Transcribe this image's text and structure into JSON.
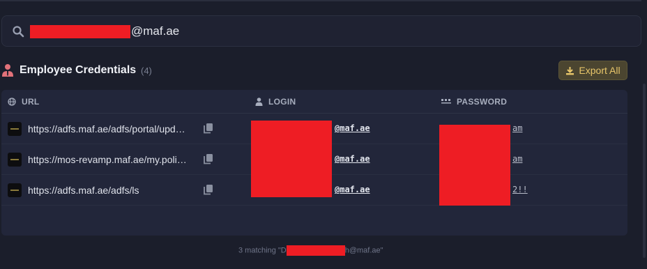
{
  "search": {
    "query_visible": "@maf.ae"
  },
  "section": {
    "title": "Employee Credentials",
    "count": "(4)",
    "export_label": "Export All"
  },
  "table": {
    "headers": {
      "url": "URL",
      "login": "LOGIN",
      "password": "PASSWORD"
    },
    "rows": [
      {
        "url": "https://adfs.maf.ae/adfs/portal/upd…",
        "login": "@maf.ae",
        "password": "am"
      },
      {
        "url": "https://mos-revamp.maf.ae/my.poli…",
        "login": "@maf.ae",
        "password": "am"
      },
      {
        "url": "https://adfs.maf.ae/adfs/ls",
        "login": "@maf.ae",
        "password": "2!!"
      }
    ]
  },
  "footer": {
    "prefix": "3 matching \"D",
    "suffix": "h@maf.ae\""
  },
  "colors": {
    "accent": "#e8c66a",
    "redaction": "#ee1d24",
    "user_icon": "#e2727a"
  }
}
